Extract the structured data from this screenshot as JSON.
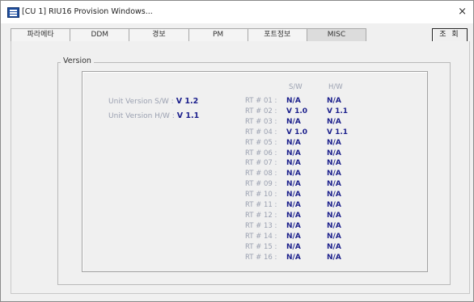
{
  "window": {
    "title": "[CU 1] RIU16 Provision Windows...",
    "close": "×"
  },
  "tabs": [
    {
      "label": "파라메타",
      "active": false
    },
    {
      "label": "DDM",
      "active": false
    },
    {
      "label": "경보",
      "active": false
    },
    {
      "label": "PM",
      "active": false
    },
    {
      "label": "포트정보",
      "active": false
    },
    {
      "label": "MISC",
      "active": true
    }
  ],
  "query_button": "조 회",
  "version": {
    "group_label": "Version",
    "unit_sw_label": "Unit Version S/W :",
    "unit_sw_value": "V 1.2",
    "unit_hw_label": "Unit Version H/W :",
    "unit_hw_value": "V 1.1",
    "sw_header": "S/W",
    "hw_header": "H/W",
    "rows": [
      {
        "label": "RT # 01 :",
        "sw": "N/A",
        "hw": "N/A"
      },
      {
        "label": "RT # 02 :",
        "sw": "V 1.0",
        "hw": "V 1.1"
      },
      {
        "label": "RT # 03 :",
        "sw": "N/A",
        "hw": "N/A"
      },
      {
        "label": "RT # 04 :",
        "sw": "V 1.0",
        "hw": "V 1.1"
      },
      {
        "label": "RT # 05 :",
        "sw": "N/A",
        "hw": "N/A"
      },
      {
        "label": "RT # 06 :",
        "sw": "N/A",
        "hw": "N/A"
      },
      {
        "label": "RT # 07 :",
        "sw": "N/A",
        "hw": "N/A"
      },
      {
        "label": "RT # 08 :",
        "sw": "N/A",
        "hw": "N/A"
      },
      {
        "label": "RT # 09 :",
        "sw": "N/A",
        "hw": "N/A"
      },
      {
        "label": "RT # 10 :",
        "sw": "N/A",
        "hw": "N/A"
      },
      {
        "label": "RT # 11 :",
        "sw": "N/A",
        "hw": "N/A"
      },
      {
        "label": "RT # 12 :",
        "sw": "N/A",
        "hw": "N/A"
      },
      {
        "label": "RT # 13 :",
        "sw": "N/A",
        "hw": "N/A"
      },
      {
        "label": "RT # 14 :",
        "sw": "N/A",
        "hw": "N/A"
      },
      {
        "label": "RT # 15 :",
        "sw": "N/A",
        "hw": "N/A"
      },
      {
        "label": "RT # 16 :",
        "sw": "N/A",
        "hw": "N/A"
      }
    ]
  },
  "colors": {
    "value_text": "#1b1f8c",
    "label_text": "#9aa0b0",
    "active_tab": "#dcdcdc"
  },
  "icons": {
    "app": "app-window-icon",
    "close": "close-icon"
  }
}
